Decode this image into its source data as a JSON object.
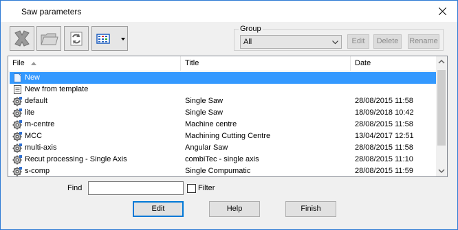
{
  "window": {
    "title": "Saw parameters"
  },
  "toolbar": {
    "delete_icon": "delete-x-icon",
    "open_icon": "folder-icon",
    "refresh_icon": "refresh-icon",
    "view_icon": "view-mode-icon"
  },
  "group": {
    "label": "Group",
    "selected": "All",
    "edit_label": "Edit",
    "delete_label": "Delete",
    "rename_label": "Rename"
  },
  "list": {
    "columns": {
      "file": "File",
      "title": "Title",
      "date": "Date"
    },
    "sort": {
      "column": "file",
      "direction": "ascending"
    },
    "rows": [
      {
        "file": "New",
        "title": "",
        "date": "",
        "icon": "new-file-icon",
        "selected": true
      },
      {
        "file": "New from template",
        "title": "",
        "date": "",
        "icon": "template-icon",
        "selected": false
      },
      {
        "file": "default",
        "title": "Single Saw",
        "date": "28/08/2015  11:58",
        "icon": "saw-gear-icon",
        "selected": false
      },
      {
        "file": "lite",
        "title": "Single Saw",
        "date": "18/09/2018  10:42",
        "icon": "saw-gear-icon",
        "selected": false
      },
      {
        "file": "m-centre",
        "title": "Machine centre",
        "date": "28/08/2015  11:58",
        "icon": "saw-gear-icon",
        "selected": false
      },
      {
        "file": "MCC",
        "title": "Machining Cutting Centre",
        "date": "13/04/2017  12:51",
        "icon": "saw-gear-icon",
        "selected": false
      },
      {
        "file": "multi-axis",
        "title": "Angular Saw",
        "date": "28/08/2015  11:58",
        "icon": "saw-gear-icon",
        "selected": false
      },
      {
        "file": "Recut processing - Single Axis",
        "title": "combiTec - single axis",
        "date": "28/08/2015  11:10",
        "icon": "saw-gear-icon",
        "selected": false
      },
      {
        "file": "s-comp",
        "title": "Single Compumatic",
        "date": "28/08/2015  11:59",
        "icon": "saw-gear-icon",
        "selected": false
      }
    ]
  },
  "find": {
    "label": "Find",
    "value": "",
    "filter_label": "Filter",
    "filter_checked": false
  },
  "buttons": {
    "edit": "Edit",
    "help": "Help",
    "finish": "Finish"
  }
}
